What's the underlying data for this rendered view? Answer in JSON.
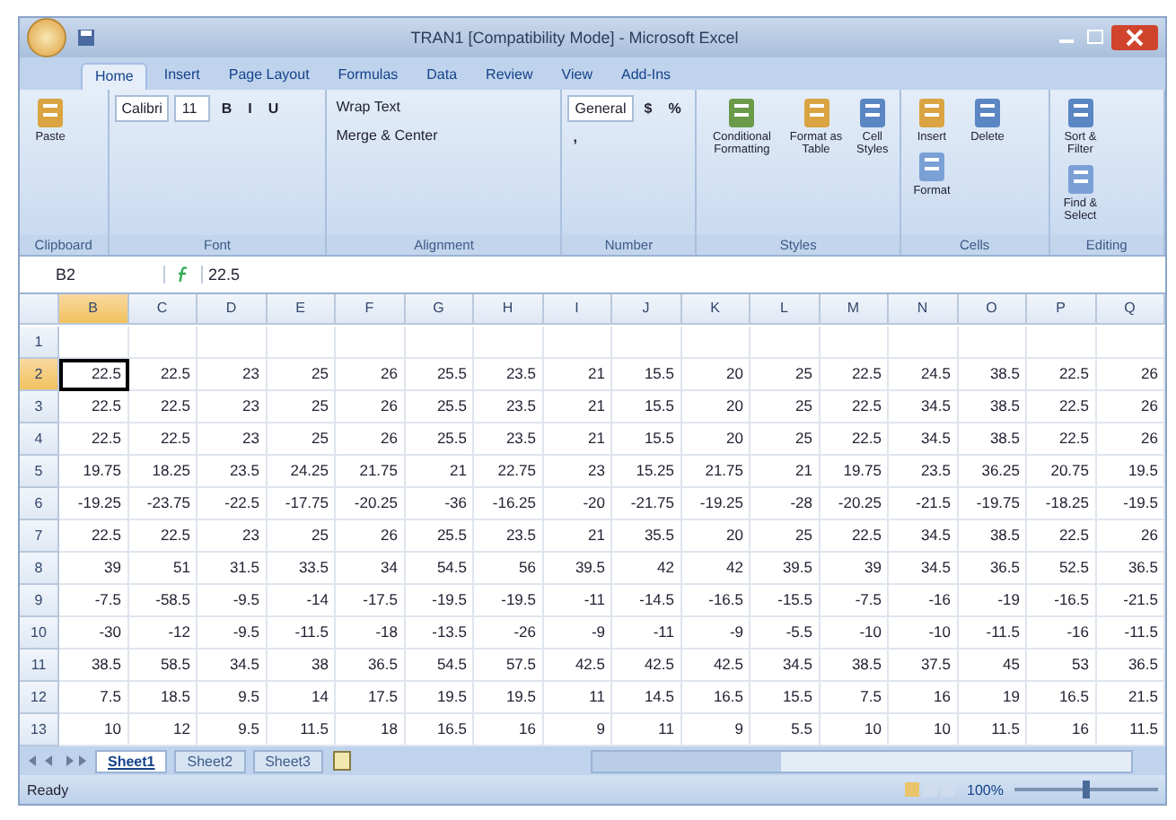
{
  "window": {
    "title": "TRAN1 [Compatibility Mode] - Microsoft Excel"
  },
  "ribbon": {
    "tabs": [
      {
        "label": "Home",
        "selected": true
      },
      {
        "label": "Insert",
        "selected": false
      },
      {
        "label": "Page Layout",
        "selected": false
      },
      {
        "label": "Formulas",
        "selected": false
      },
      {
        "label": "Data",
        "selected": false
      },
      {
        "label": "Review",
        "selected": false
      },
      {
        "label": "View",
        "selected": false
      },
      {
        "label": "Add-Ins",
        "selected": false
      }
    ],
    "groups": [
      {
        "name": "Clipboard",
        "controls": [
          {
            "kind": "large",
            "label": "Paste"
          }
        ]
      },
      {
        "name": "Font",
        "controls": [
          {
            "kind": "field",
            "label": "Calibri"
          },
          {
            "kind": "field",
            "label": "11"
          },
          {
            "kind": "format",
            "label": "B"
          },
          {
            "kind": "format",
            "label": "I"
          },
          {
            "kind": "format",
            "label": "U"
          }
        ]
      },
      {
        "name": "Alignment",
        "controls": [
          {
            "kind": "small",
            "label": "Wrap Text"
          },
          {
            "kind": "small",
            "label": "Merge & Center"
          }
        ]
      },
      {
        "name": "Number",
        "controls": [
          {
            "kind": "field",
            "label": "General"
          },
          {
            "kind": "format",
            "label": "$"
          },
          {
            "kind": "format",
            "label": "%"
          },
          {
            "kind": "format",
            "label": ","
          }
        ]
      },
      {
        "name": "Styles",
        "controls": [
          {
            "kind": "large",
            "label": "Conditional Formatting"
          },
          {
            "kind": "large",
            "label": "Format as Table"
          },
          {
            "kind": "large",
            "label": "Cell Styles"
          }
        ]
      },
      {
        "name": "Cells",
        "controls": [
          {
            "kind": "large",
            "label": "Insert"
          },
          {
            "kind": "large",
            "label": "Delete"
          },
          {
            "kind": "large",
            "label": "Format"
          }
        ]
      },
      {
        "name": "Editing",
        "controls": [
          {
            "kind": "large",
            "label": "Sort & Filter"
          },
          {
            "kind": "large",
            "label": "Find & Select"
          }
        ]
      }
    ]
  },
  "formula_bar": {
    "name_box": "B2",
    "formula": "22.5"
  },
  "sheet": {
    "columns": [
      {
        "label": "B",
        "selected": true
      },
      {
        "label": "C",
        "selected": false
      },
      {
        "label": "D",
        "selected": false
      },
      {
        "label": "E",
        "selected": false
      },
      {
        "label": "F",
        "selected": false
      },
      {
        "label": "G",
        "selected": false
      },
      {
        "label": "H",
        "selected": false
      },
      {
        "label": "I",
        "selected": false
      },
      {
        "label": "J",
        "selected": false
      },
      {
        "label": "K",
        "selected": false
      },
      {
        "label": "L",
        "selected": false
      },
      {
        "label": "M",
        "selected": false
      },
      {
        "label": "N",
        "selected": false
      },
      {
        "label": "O",
        "selected": false
      },
      {
        "label": "P",
        "selected": false
      },
      {
        "label": "Q",
        "selected": false
      }
    ],
    "rows": [
      {
        "label": "1",
        "selected": false
      },
      {
        "label": "2",
        "selected": true,
        "cells": [
          "22.5",
          "22.5",
          "23",
          "25",
          "26",
          "25.5",
          "23.5",
          "21",
          "15.5",
          "20",
          "25",
          "22.5",
          "24.5",
          "38.5",
          "22.5",
          "26"
        ]
      },
      {
        "label": "3",
        "selected": false,
        "cells": [
          "22.5",
          "22.5",
          "23",
          "25",
          "26",
          "25.5",
          "23.5",
          "21",
          "15.5",
          "20",
          "25",
          "22.5",
          "34.5",
          "38.5",
          "22.5",
          "26"
        ]
      },
      {
        "label": "4",
        "selected": false,
        "cells": [
          "22.5",
          "22.5",
          "23",
          "25",
          "26",
          "25.5",
          "23.5",
          "21",
          "15.5",
          "20",
          "25",
          "22.5",
          "34.5",
          "38.5",
          "22.5",
          "26"
        ]
      },
      {
        "label": "5",
        "selected": false,
        "cells": [
          "19.75",
          "18.25",
          "23.5",
          "24.25",
          "21.75",
          "21",
          "22.75",
          "23",
          "15.25",
          "21.75",
          "21",
          "19.75",
          "23.5",
          "36.25",
          "20.75",
          "19.5"
        ]
      },
      {
        "label": "6",
        "selected": false,
        "cells": [
          "-19.25",
          "-23.75",
          "-22.5",
          "-17.75",
          "-20.25",
          "-36",
          "-16.25",
          "-20",
          "-21.75",
          "-19.25",
          "-28",
          "-20.25",
          "-21.5",
          "-19.75",
          "-18.25",
          "-19.5"
        ]
      },
      {
        "label": "7",
        "selected": false,
        "cells": [
          "22.5",
          "22.5",
          "23",
          "25",
          "26",
          "25.5",
          "23.5",
          "21",
          "35.5",
          "20",
          "25",
          "22.5",
          "34.5",
          "38.5",
          "22.5",
          "26"
        ]
      },
      {
        "label": "8",
        "selected": false,
        "cells": [
          "39",
          "51",
          "31.5",
          "33.5",
          "34",
          "54.5",
          "56",
          "39.5",
          "42",
          "42",
          "39.5",
          "39",
          "34.5",
          "36.5",
          "52.5",
          "36.5"
        ]
      },
      {
        "label": "9",
        "selected": false,
        "cells": [
          "-7.5",
          "-58.5",
          "-9.5",
          "-14",
          "-17.5",
          "-19.5",
          "-19.5",
          "-11",
          "-14.5",
          "-16.5",
          "-15.5",
          "-7.5",
          "-16",
          "-19",
          "-16.5",
          "-21.5"
        ]
      },
      {
        "label": "10",
        "selected": false,
        "cells": [
          "-30",
          "-12",
          "-9.5",
          "-11.5",
          "-18",
          "-13.5",
          "-26",
          "-9",
          "-11",
          "-9",
          "-5.5",
          "-10",
          "-10",
          "-11.5",
          "-16",
          "-11.5"
        ]
      },
      {
        "label": "11",
        "selected": false,
        "cells": [
          "38.5",
          "58.5",
          "34.5",
          "38",
          "36.5",
          "54.5",
          "57.5",
          "42.5",
          "42.5",
          "42.5",
          "34.5",
          "38.5",
          "37.5",
          "45",
          "53",
          "36.5"
        ]
      },
      {
        "label": "12",
        "selected": false,
        "cells": [
          "7.5",
          "18.5",
          "9.5",
          "14",
          "17.5",
          "19.5",
          "19.5",
          "11",
          "14.5",
          "16.5",
          "15.5",
          "7.5",
          "16",
          "19",
          "16.5",
          "21.5"
        ]
      },
      {
        "label": "13",
        "selected": false,
        "cells": [
          "10",
          "12",
          "9.5",
          "11.5",
          "18",
          "16.5",
          "16",
          "9",
          "11",
          "9",
          "5.5",
          "10",
          "10",
          "11.5",
          "16",
          "11.5"
        ]
      }
    ]
  },
  "sheet_tabs": [
    {
      "label": "Sheet1",
      "selected": true
    },
    {
      "label": "Sheet2",
      "selected": false
    },
    {
      "label": "Sheet3",
      "selected": false
    }
  ],
  "status_bar": {
    "status": "Ready",
    "zoom": "100%",
    "zoom_slider": {
      "level": 0.5
    }
  }
}
